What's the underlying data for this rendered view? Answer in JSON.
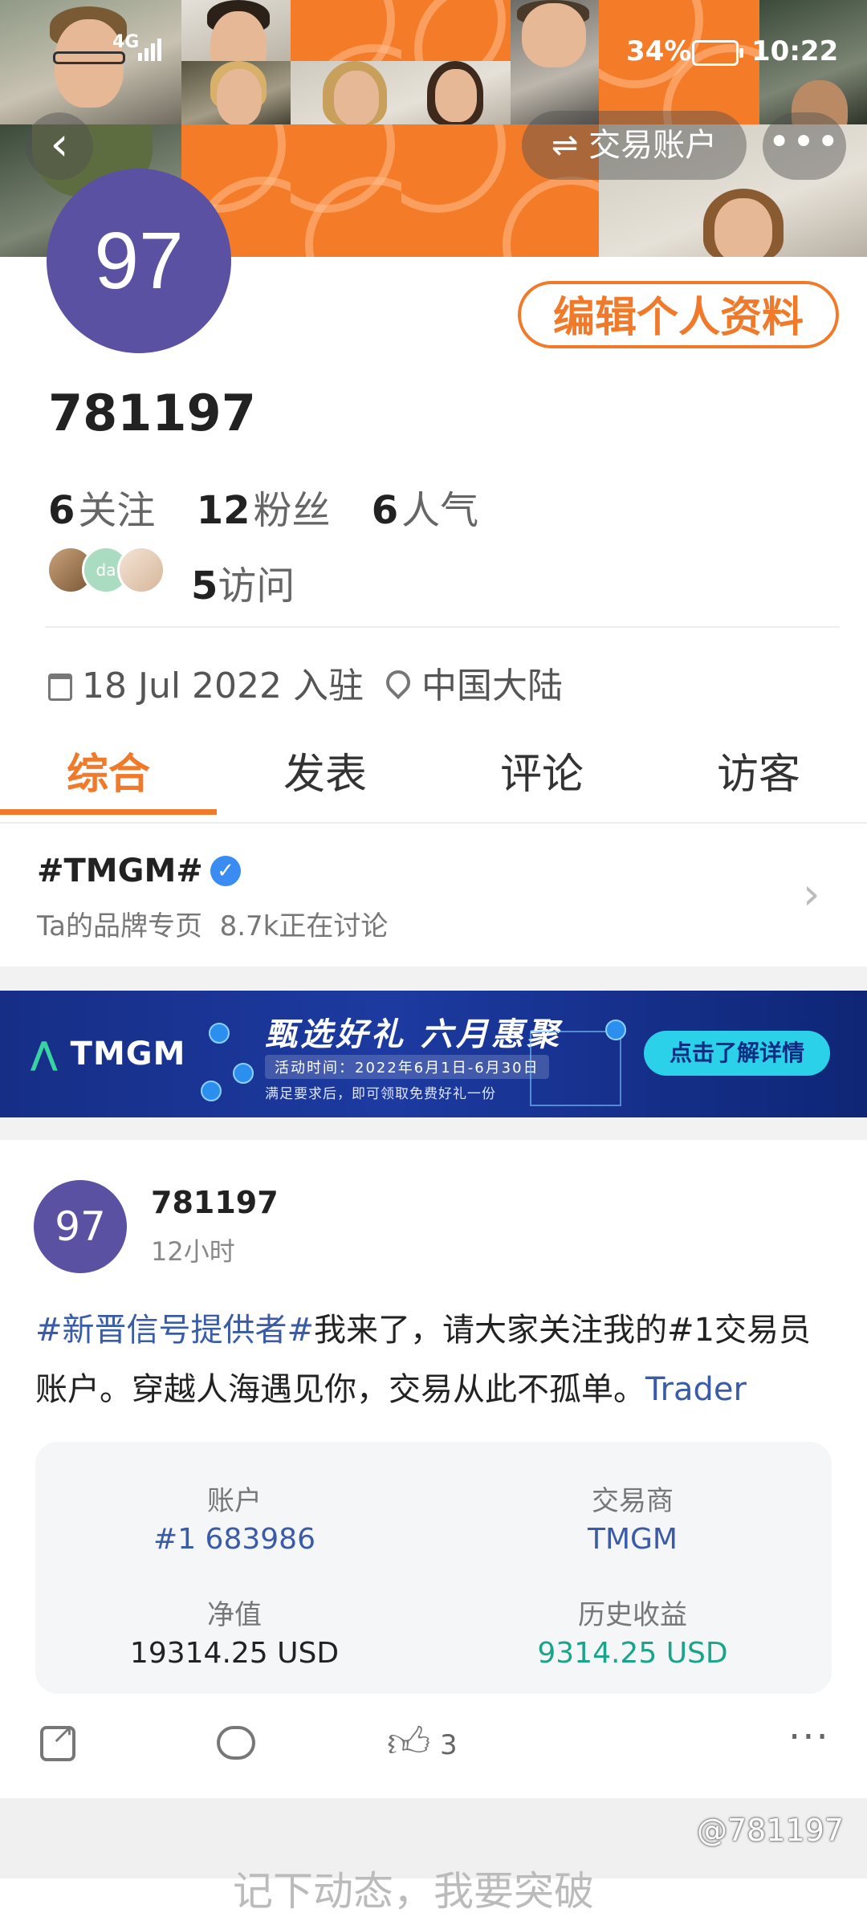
{
  "status_bar": {
    "network": "4G",
    "battery": "34%",
    "time": "10:22"
  },
  "header": {
    "back_icon": "chevron-left-icon",
    "account_switch_label": "⇌ 交易账户",
    "more_icon": "more-dots-icon"
  },
  "profile": {
    "avatar_text": "97",
    "edit_button": "编辑个人资料",
    "username": "781197",
    "following_count": "6",
    "following_label": "关注",
    "followers_count": "12",
    "followers_label": "粉丝",
    "popularity_count": "6",
    "popularity_label": "人气",
    "visits_count": "5",
    "visits_label": "访问",
    "joined": "18 Jul 2022 入驻",
    "location": "中国大陆"
  },
  "tabs": [
    {
      "label": "综合",
      "active": true
    },
    {
      "label": "发表",
      "active": false
    },
    {
      "label": "评论",
      "active": false
    },
    {
      "label": "访客",
      "active": false
    }
  ],
  "topic": {
    "title": "#TMGM#",
    "subtitle": "Ta的品牌专页",
    "discussion": "8.7k正在讨论"
  },
  "banner": {
    "logo": "TMGM",
    "title": "甄选好礼 六月惠聚",
    "date": "活动时间：2022年6月1日-6月30日",
    "note": "满足要求后，即可领取免费好礼一份",
    "cta": "点击了解详情"
  },
  "post": {
    "avatar_text": "97",
    "username": "781197",
    "time": "12小时",
    "hashtag": "#新晋信号提供者#",
    "text_line": "我来了，请大家关注我的#1交易员账户。穿越人海遇见你，交易从此不孤单。",
    "trailing_link": "Trader",
    "card": {
      "account_label": "账户",
      "account_value": "#1 683986",
      "broker_label": "交易商",
      "broker_value": "TMGM",
      "equity_label": "净值",
      "equity_value": "19314.25 USD",
      "profit_label": "历史收益",
      "profit_value": "9314.25 USD"
    },
    "like_count": "3",
    "more": "···"
  },
  "colors": {
    "accent": "#f07a2a",
    "avatar": "#5b51a3",
    "link": "#3a5ba8",
    "profit": "#1aa58a"
  },
  "watermark": "@781197",
  "cut_off_text": "记下动态，我要突破"
}
